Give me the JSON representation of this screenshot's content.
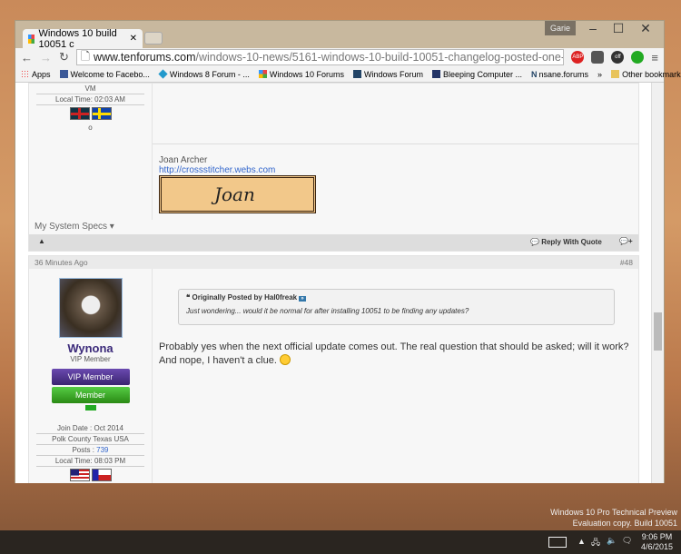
{
  "browser": {
    "tab_title": "Windows 10 build 10051 c",
    "guest_label": "Garie",
    "url_domain": "www.tenforums.com",
    "url_path": "/windows-10-news/5161-windows-10-build-10051-changelog-posted-one-minor-u",
    "bookmarks": [
      "Apps",
      "Welcome to Facebo...",
      "Windows 8 Forum - ...",
      "Windows 10 Forums",
      "Windows Forum",
      "Bleeping Computer ...",
      "nsane.forums",
      "»",
      "Other bookmarks"
    ],
    "ext_abp": "ABP",
    "ext_off": "off"
  },
  "prev_post": {
    "user_vm": "VM",
    "local_time": "Local Time: 02:03 AM",
    "dot": "o",
    "sig_name": "Joan Archer",
    "sig_link": "http://crossstitcher.webs.com",
    "sig_banner": "Joan",
    "system_specs": "My System Specs",
    "reply_quote": "Reply With Quote"
  },
  "post": {
    "time": "36 Minutes Ago",
    "number": "#48",
    "username": "Wynona",
    "title": "VIP Member",
    "badge1": "VIP Member",
    "badge2": "Member",
    "join_date": "Join Date : Oct 2014",
    "location": "Polk County Texas USA",
    "posts_label": "Posts : ",
    "posts_count": "739",
    "local_time": "Local Time: 08:03 PM",
    "quote_header": "Originally Posted by ",
    "quote_author": "Hal0freak",
    "quote_text": "Just wondering... would it be normal for after installing 10051 to be finding any updates?",
    "body": "Probably yes when the next official update comes out. The real question that should be asked; will it work? And nope, I haven't a clue."
  },
  "desktop": {
    "watermark1": "Windows 10 Pro Technical Preview",
    "watermark2": "Evaluation copy. Build 10051",
    "time": "9:06 PM",
    "date": "4/6/2015"
  }
}
